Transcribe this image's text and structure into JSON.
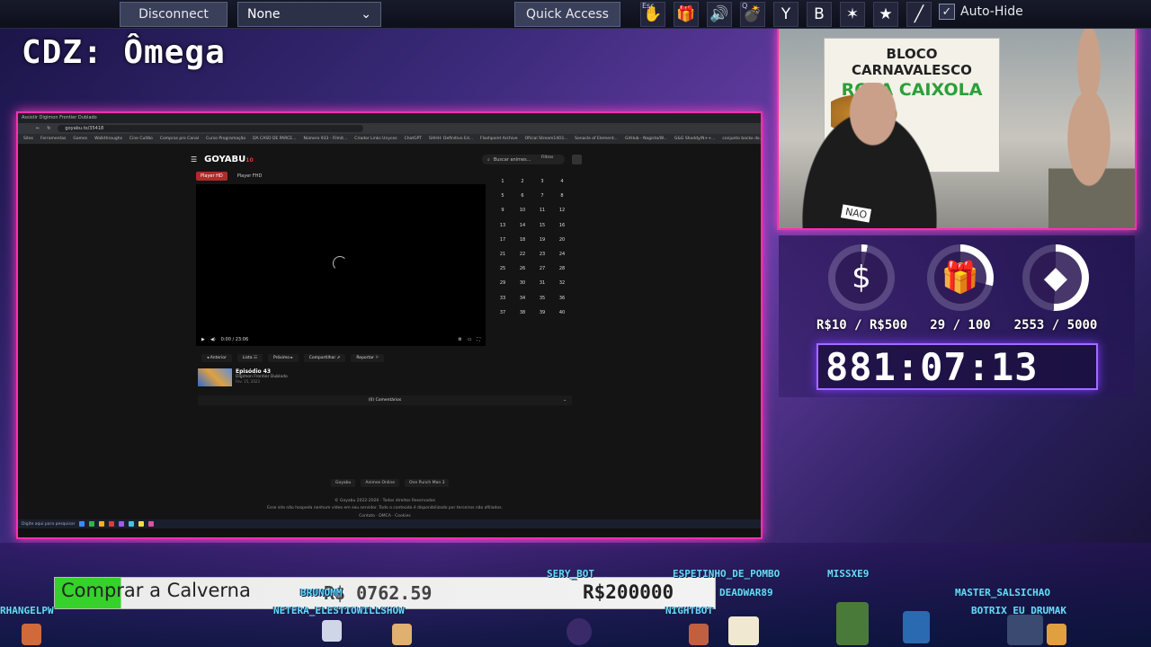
{
  "toolbar": {
    "disconnect_label": "Disconnect",
    "select_value": "None",
    "quick_access_label": "Quick Access",
    "auto_hide_label": "Auto-Hide",
    "icons": [
      {
        "name": "hand-icon",
        "key": "Esc",
        "glyph": "✋"
      },
      {
        "name": "gift-icon",
        "key": "",
        "glyph": "🎁"
      },
      {
        "name": "speaker-icon",
        "key": "",
        "glyph": "🔊"
      },
      {
        "name": "bomb-icon",
        "key": "Q",
        "glyph": "💣"
      },
      {
        "name": "slingshot-icon",
        "key": "",
        "glyph": "Y"
      },
      {
        "name": "b-icon",
        "key": "",
        "glyph": "B"
      },
      {
        "name": "bug-icon",
        "key": "",
        "glyph": "✶"
      },
      {
        "name": "star-icon",
        "key": "",
        "glyph": "★"
      },
      {
        "name": "syringe-icon",
        "key": "",
        "glyph": "╱"
      }
    ]
  },
  "stream": {
    "title": "CDZ: Ômega"
  },
  "browser": {
    "tab_title": "Assistir Digimon Frontier Dublado",
    "url": "goyabu.to/35418",
    "bookmarks": [
      "Sites",
      "Ferramentas",
      "Games",
      "Walkthroughs",
      "Cine Cultão",
      "Compras pro Canal",
      "Curso Programação",
      "DA CASO DE PARCE...",
      "Número 933 - Filmit...",
      "Criador Links Unycos",
      "ChatGPT",
      "SHHH: Definitivo Ed...",
      "Flashpoint Archive",
      "Oficial Stream1403...",
      "Sonacle of Element...",
      "GitHub - Nagista/W...",
      "G&G Shoddy/N++...",
      "conjunto backo do..."
    ],
    "site": {
      "logo": "GOYABU",
      "logo_badge": "10",
      "search_placeholder": "Buscar animes...",
      "filter_label": "Filtros",
      "player_tabs": [
        "Player HD",
        "Player FHD"
      ],
      "video_time": "0:00 / 23:06",
      "episodes": [
        "1",
        "2",
        "3",
        "4",
        "5",
        "6",
        "7",
        "8",
        "9",
        "10",
        "11",
        "12",
        "13",
        "14",
        "15",
        "16",
        "17",
        "18",
        "19",
        "20",
        "21",
        "22",
        "23",
        "24",
        "25",
        "26",
        "27",
        "28",
        "29",
        "30",
        "31",
        "32",
        "33",
        "34",
        "35",
        "36",
        "37",
        "38",
        "39",
        "40"
      ],
      "nav": {
        "prev": "◂ Anterior",
        "list": "Lista ☷",
        "next": "Próximo ▸",
        "share": "Compartilhar ⇗",
        "report": "Reportar ⚐"
      },
      "episode_title": "Episódio 43",
      "episode_series": "Digimon Frontier Dublado",
      "episode_date": "Fev. 15, 2023",
      "comments_label": "(0) Comentários",
      "footer_links": [
        "Goyabu",
        "Animes Online",
        "One Punch Man 3"
      ],
      "footer_copyright": "© Goyabu 2022-2026 · Todos direitos Reservados",
      "footer_disclaimer": "Esse site não hospeda nenhum vídeo em seu servidor. Todo o conteúdo é disponibilizado por terceiros não afiliados.",
      "footer_small": "Contato · DMCA · Cookies"
    },
    "taskbar_search": "Digite aqui para pesquisar"
  },
  "webcam": {
    "sign_line1": "BLOCO CARNAVALESCO",
    "sign_line2": "ROLA CAIXOLA",
    "shirt_label": "NAO"
  },
  "goals": [
    {
      "icon": "dollar-icon",
      "glyph": "$",
      "value": "R$10 / R$500",
      "progress": 0.02
    },
    {
      "icon": "gift-icon",
      "glyph": "🎁",
      "value": "29 / 100",
      "progress": 0.29
    },
    {
      "icon": "diamond-icon",
      "glyph": "◆",
      "value": "2553 / 5000",
      "progress": 0.51
    }
  ],
  "timer": "881:07:13",
  "calverna": {
    "label": "Comprar a Calverna",
    "current": "R$ 0762.59",
    "goal": "R$200000",
    "progress": 0.1
  },
  "usernames": [
    "SERY_BOT",
    "ESPETINHO_DE_POMBO",
    "MISSXE9",
    "BRUNOMM",
    "DEADWAR89",
    "MASTER_SALSICHAO",
    "RHANGELPW",
    "NETERA_ELESTIOWILLSHOW",
    "NIGHTBOT",
    "BOTRIX EU_DRUMAK"
  ],
  "colors": {
    "accent": "#ff2fae",
    "timer_border": "#a36cff",
    "progress_green": "#36d12a",
    "username": "#6ad8ff"
  }
}
